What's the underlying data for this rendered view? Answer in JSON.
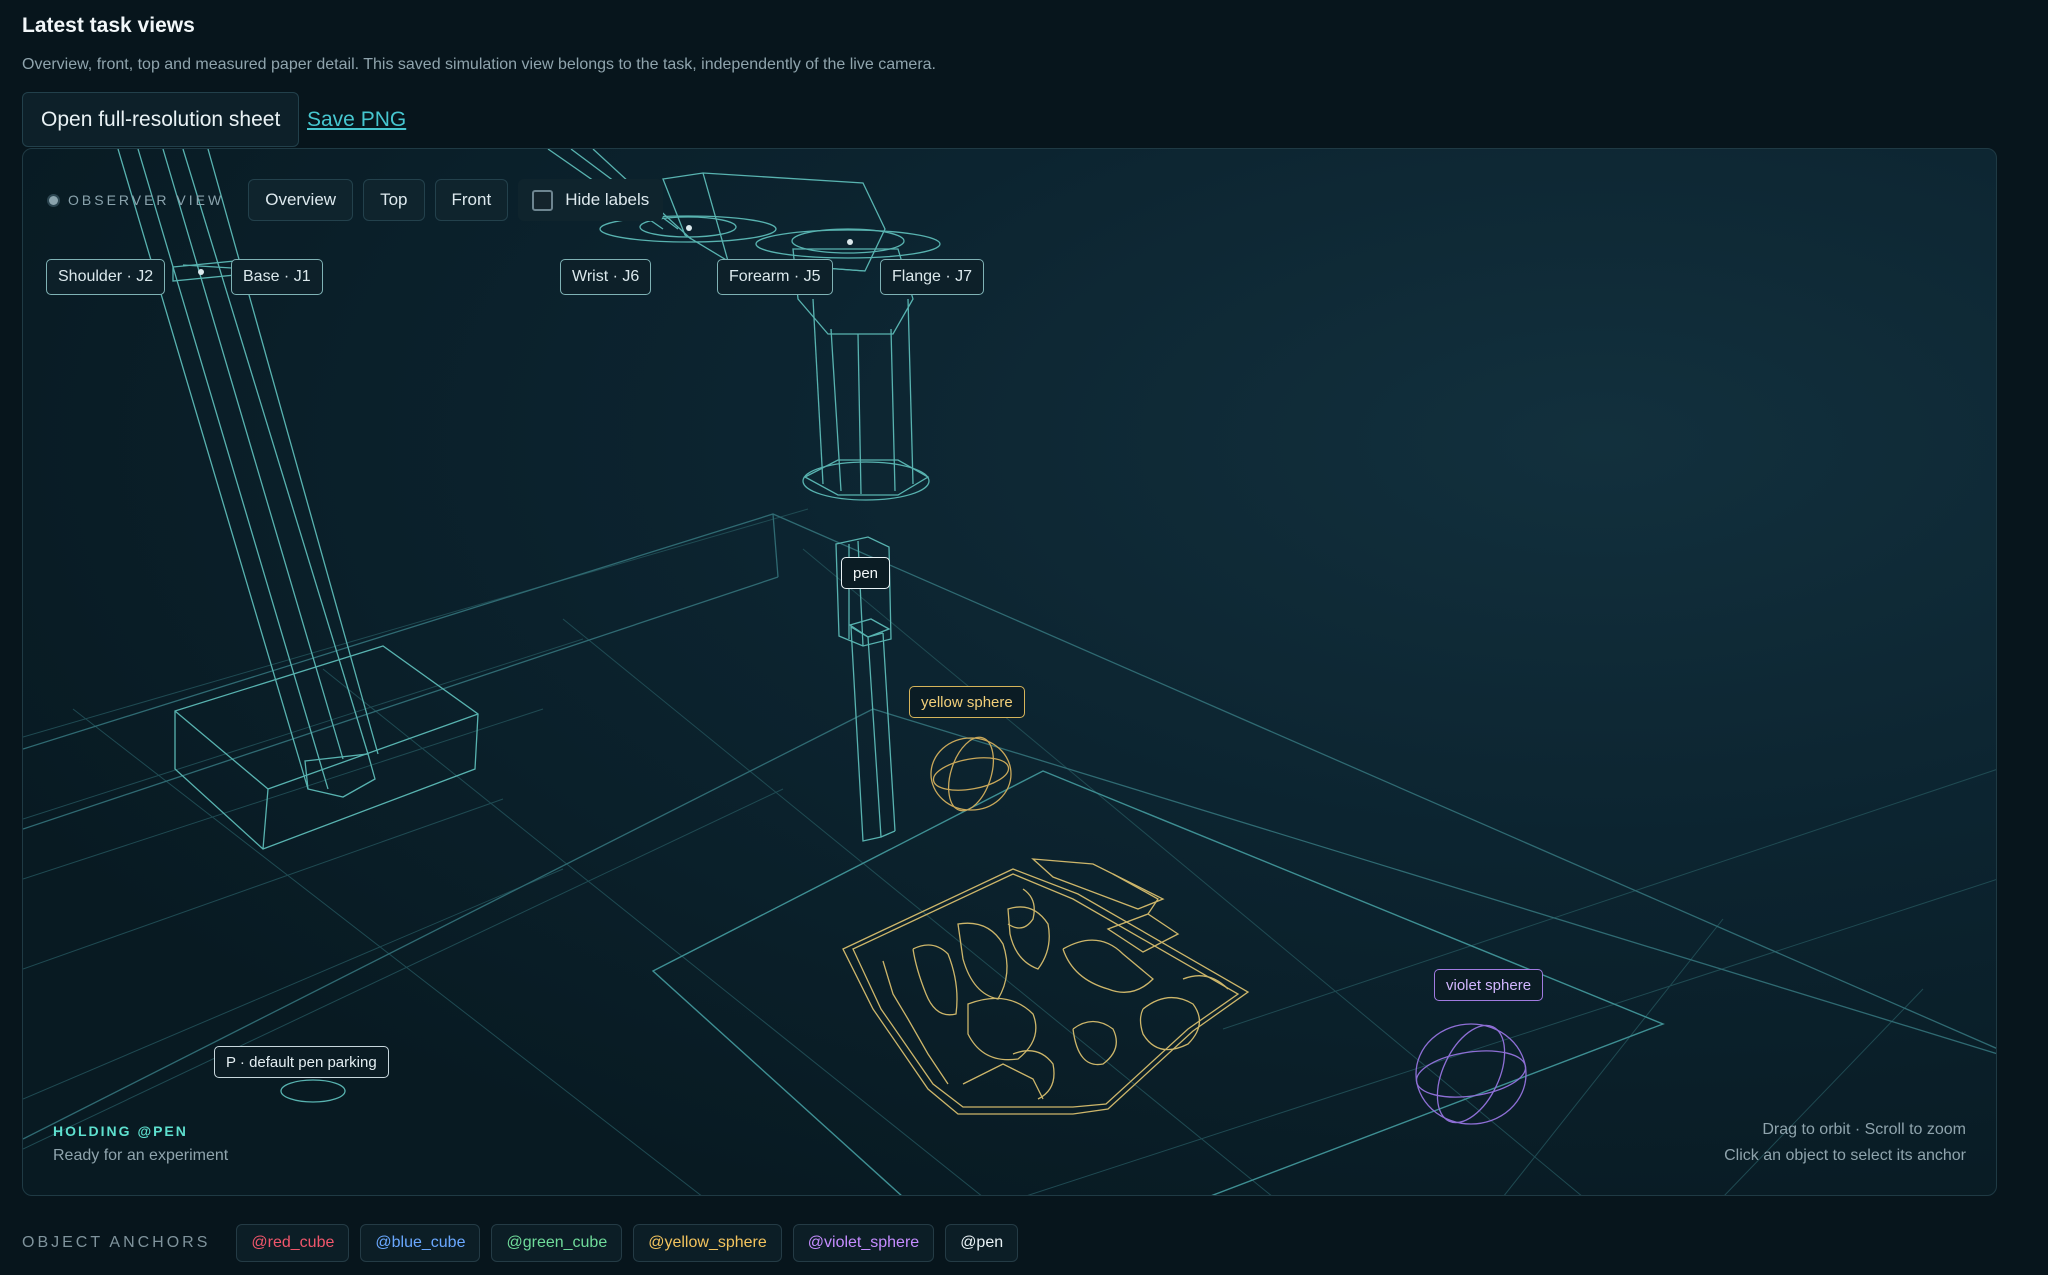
{
  "header": {
    "title": "Latest task views",
    "subtitle": "Overview, front, top and measured paper detail. This saved simulation view belongs to the task, independently of the live camera.",
    "open_button": "Open full-resolution sheet",
    "save_link": "Save PNG"
  },
  "viewer": {
    "observer_label": "OBSERVER VIEW",
    "buttons": {
      "overview": "Overview",
      "top": "Top",
      "front": "Front"
    },
    "hide_labels": {
      "label": "Hide labels",
      "checked": false
    },
    "joints": {
      "shoulder": "Shoulder · J2",
      "base": "Base · J1",
      "wrist": "Wrist · J6",
      "forearm": "Forearm · J5",
      "flange": "Flange · J7"
    },
    "objects": {
      "pen": "pen",
      "yellow_sphere": "yellow sphere",
      "violet_sphere": "violet sphere",
      "parking": "P · default pen parking"
    },
    "status": {
      "holding": "HOLDING @PEN",
      "ready": "Ready for an experiment"
    },
    "hints": {
      "orbit": "Drag to orbit · Scroll to zoom",
      "select": "Click an object to select its anchor"
    }
  },
  "anchors": {
    "label": "OBJECT ANCHORS",
    "items": [
      {
        "label": "@red_cube",
        "color": "#f0566b"
      },
      {
        "label": "@blue_cube",
        "color": "#6aa8ff"
      },
      {
        "label": "@green_cube",
        "color": "#6fdb9a"
      },
      {
        "label": "@yellow_sphere",
        "color": "#f2c35e"
      },
      {
        "label": "@violet_sphere",
        "color": "#c58cff"
      },
      {
        "label": "@pen",
        "color": "#e9f2f5"
      }
    ]
  },
  "colors": {
    "wire": "#4fa8a8",
    "yellow": "#d6b45a",
    "violet": "#a07be0",
    "accent": "#46c6cf"
  }
}
